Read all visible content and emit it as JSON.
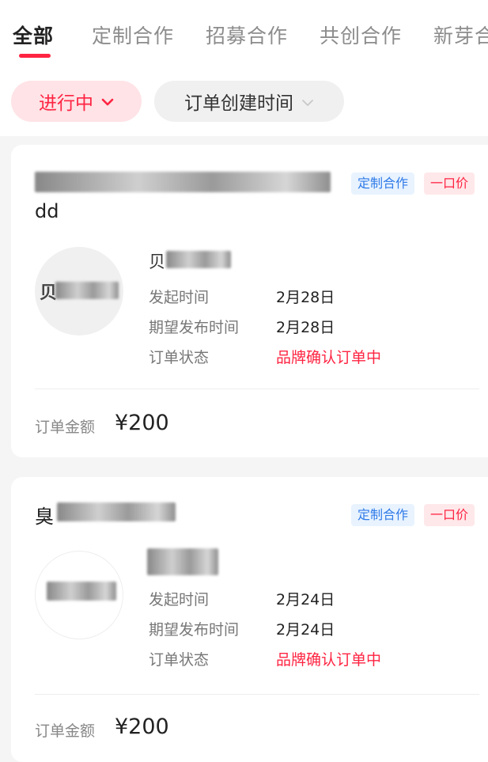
{
  "tabs": [
    {
      "label": "全部",
      "active": true
    },
    {
      "label": "定制合作"
    },
    {
      "label": "招募合作"
    },
    {
      "label": "共创合作"
    },
    {
      "label": "新芽合"
    }
  ],
  "filters": {
    "status_label": "进行中",
    "sort_label": "订单创建时间"
  },
  "labels": {
    "start_time": "发起时间",
    "expected_publish": "期望发布时间",
    "order_status": "订单状态",
    "order_amount": "订单金额"
  },
  "orders": [
    {
      "title_tail": "dd",
      "tags": [
        "定制合作",
        "一口价"
      ],
      "avatar_text": "贝",
      "kol_name": "贝",
      "start_date": "2月28日",
      "publish_date": "2月28日",
      "status": "品牌确认订单中",
      "amount": "¥200"
    },
    {
      "title_head": "臭",
      "tags": [
        "定制合作",
        "一口价"
      ],
      "start_date": "2月24日",
      "publish_date": "2月24日",
      "status": "品牌确认订单中",
      "amount": "¥200"
    }
  ],
  "colors": {
    "accent": "#ff2442",
    "tag_blue": "#2f7ae8",
    "tag_blue_bg": "#e8f3ff"
  }
}
